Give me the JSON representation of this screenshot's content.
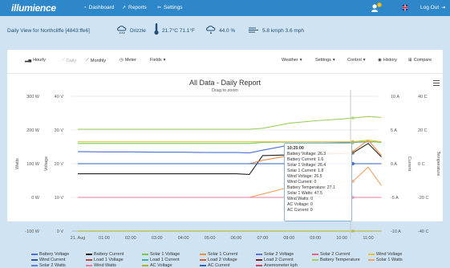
{
  "nav": {
    "brand": "illumience",
    "dashboard": "Dashboard",
    "reports": "Reports",
    "settings": "Settings",
    "logout": "Log Out",
    "notification_count": "1"
  },
  "weather_bar": {
    "daily_view": "Daily View for Northcliffe [4843:ffe6]",
    "condition": "Drizzle",
    "temperature": "21.7°C  71.1°F",
    "humidity": "44.0 %",
    "wind": "5.8  kmph  3.6  mph"
  },
  "toolbar": {
    "hourly": "Hourly",
    "daily": "Daily",
    "monthly": "Monthly",
    "meter": "Meter",
    "fields": "Fields",
    "weather": "Weather",
    "settings": "Settings",
    "control": "Control",
    "history": "History",
    "compare": "Compare"
  },
  "chart": {
    "title": "All Data - Daily Report",
    "subtitle": "Drag to zoom",
    "watts_label": "Watts",
    "voltage_label": "Voltage",
    "current_label": "Current",
    "temperature_label": "Temperature",
    "watts_ticks": [
      "300 W",
      "200 W",
      "100 W",
      "0 W",
      "-100 W"
    ],
    "voltage_ticks": [
      "40 V",
      "30 V",
      "20 V",
      "10 V",
      "0 V"
    ],
    "current_ticks": [
      "10 A",
      "5 A",
      "0 A",
      "-5 A",
      "-10 A"
    ],
    "temp_ticks": [
      "40 C",
      "20 C",
      "0 C",
      "-20 C",
      "-40 C"
    ],
    "x_ticks": [
      "21. Aug",
      "01:00",
      "02:00",
      "03:00",
      "04:00",
      "05:00",
      "06:00",
      "07:00",
      "08:00",
      "09:00",
      "10:00",
      "11:00"
    ]
  },
  "tooltip": {
    "time": "10:25:00",
    "lines": [
      "Battery Voltage: 26.3",
      "Battery Current: 1.6",
      "Solar 1 Voltage: 26.4",
      "Solar 1 Current: 1.8",
      "Wind Voltage: 26.5",
      "Wind Current: 0",
      "Battery Temperature: 27.1",
      "Solar 1 Watts: 47.5",
      "Wind Watts: 0",
      "AC Voltage: 0",
      "AC Current: 0"
    ]
  },
  "legend": [
    {
      "name": "Battery Voltage",
      "color": "#4a6fd6"
    },
    {
      "name": "Battery Current",
      "color": "#222222"
    },
    {
      "name": "Solar 1 Voltage",
      "color": "#78c850"
    },
    {
      "name": "Solar 1 Current",
      "color": "#f08c40"
    },
    {
      "name": "Solar 2 Voltage",
      "color": "#6070e0"
    },
    {
      "name": "Solar 2 Current",
      "color": "#f06080"
    },
    {
      "name": "Wind Voltage",
      "color": "#e0c040"
    },
    {
      "name": "Wind Current",
      "color": "#3050a0"
    },
    {
      "name": "Load 1 Voltage",
      "color": "#c04040"
    },
    {
      "name": "Load 1 Current",
      "color": "#40b0a0"
    },
    {
      "name": "Load 2 Voltage",
      "color": "#d06030"
    },
    {
      "name": "Load 2 Current",
      "color": "#702020"
    },
    {
      "name": "Battery Temperature",
      "color": "#a0d060"
    },
    {
      "name": "Solar 1 Watts",
      "color": "#f0a060"
    },
    {
      "name": "Solar 2 Watts",
      "color": "#6080d0"
    },
    {
      "name": "Wind Watts",
      "color": "#e080a0"
    },
    {
      "name": "AC Voltage",
      "color": "#b0b030"
    },
    {
      "name": "AC Current",
      "color": "#3060c0"
    },
    {
      "name": "Anemometer kph",
      "color": "#d04060"
    }
  ],
  "chart_data": {
    "type": "line",
    "title": "All Data - Daily Report",
    "subtitle": "Drag to zoom",
    "x": [
      "00:00",
      "01:00",
      "02:00",
      "03:00",
      "04:00",
      "05:00",
      "06:00",
      "06:30",
      "07:00",
      "08:00",
      "09:00",
      "10:00",
      "10:25",
      "11:00",
      "11:30"
    ],
    "y_axes": {
      "watts": [
        -100,
        300
      ],
      "voltage": [
        0,
        40
      ],
      "current": [
        -10,
        10
      ],
      "temperature": [
        -40,
        40
      ]
    },
    "series": [
      {
        "name": "Battery Voltage",
        "axis": "voltage",
        "values": [
          23.6,
          23.5,
          23.5,
          23.4,
          23.4,
          23.3,
          23.3,
          23.2,
          24.0,
          25.5,
          26.0,
          26.2,
          26.3,
          26.5,
          26.4
        ]
      },
      {
        "name": "Battery Current",
        "axis": "current",
        "values": [
          -1.5,
          -1.5,
          -1.5,
          -1.5,
          -1.5,
          -1.5,
          -1.5,
          -1.6,
          1.2,
          1.3,
          1.4,
          1.5,
          1.6,
          3.0,
          1.0
        ]
      },
      {
        "name": "Solar 1 Voltage",
        "axis": "voltage",
        "values": [
          26.0,
          26.0,
          26.0,
          26.0,
          26.0,
          26.0,
          26.0,
          26.0,
          26.3,
          26.4,
          26.4,
          26.4,
          26.4,
          26.6,
          26.3
        ]
      },
      {
        "name": "Solar 1 Current",
        "axis": "current",
        "values": [
          0,
          0,
          0,
          0,
          0,
          0,
          0,
          0,
          0.5,
          1.2,
          1.5,
          1.7,
          1.8,
          3.5,
          1.2
        ]
      },
      {
        "name": "Wind Voltage",
        "axis": "voltage",
        "values": [
          26.5,
          26.5,
          26.5,
          26.5,
          26.5,
          26.5,
          26.5,
          26.5,
          26.5,
          26.5,
          26.5,
          26.5,
          26.5,
          27.0,
          26.5
        ]
      },
      {
        "name": "Wind Current",
        "axis": "current",
        "values": [
          0,
          0,
          0,
          0,
          0,
          0,
          0,
          0,
          0,
          0,
          0,
          0,
          0,
          0,
          0
        ]
      },
      {
        "name": "Battery Temperature",
        "axis": "temperature",
        "values": [
          20.5,
          20.5,
          20.5,
          20.5,
          20.5,
          20.5,
          20.5,
          20.5,
          21.0,
          24.0,
          25.5,
          26.5,
          27.1,
          28.0,
          27.5
        ]
      },
      {
        "name": "Solar 1 Watts",
        "axis": "watts",
        "values": [
          0,
          0,
          0,
          0,
          0,
          0,
          0,
          0,
          10,
          30,
          40,
          45,
          47.5,
          90,
          35
        ]
      },
      {
        "name": "Wind Watts",
        "axis": "watts",
        "values": [
          0,
          0,
          0,
          0,
          0,
          0,
          0,
          0,
          0,
          0,
          0,
          0,
          0,
          0,
          0
        ]
      },
      {
        "name": "AC Voltage",
        "axis": "voltage",
        "values": [
          0,
          0,
          0,
          0,
          0,
          0,
          0,
          0,
          0,
          0,
          0,
          0,
          0,
          0,
          0
        ]
      },
      {
        "name": "AC Current",
        "axis": "current",
        "values": [
          0,
          0,
          0,
          0,
          0,
          0,
          0,
          0,
          0,
          0,
          0,
          0,
          0,
          0,
          0
        ]
      }
    ]
  }
}
